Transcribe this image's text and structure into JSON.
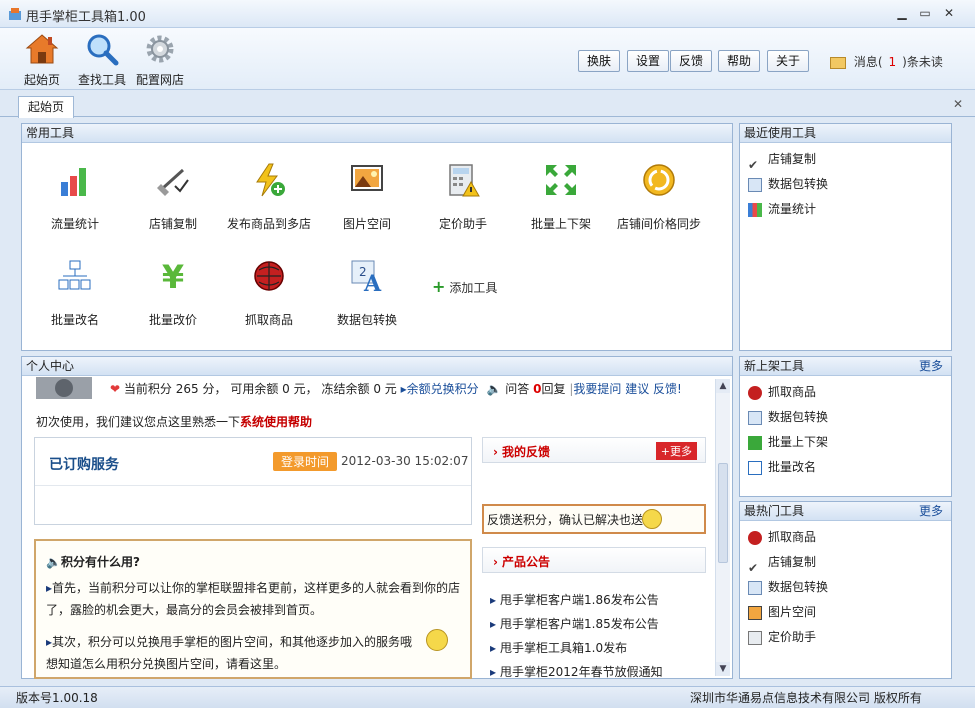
{
  "window": {
    "title": "甩手掌柜工具箱1.00"
  },
  "toolbar": {
    "home_label": "起始页",
    "find_label": "查找工具",
    "config_label": "配置网店",
    "buttons": [
      "换肤",
      "设置",
      "反馈",
      "帮助",
      "关于"
    ],
    "msg_prefix": "消息(",
    "msg_count": "1",
    "msg_suffix": ")条未读"
  },
  "tabs": {
    "start": "起始页"
  },
  "common": {
    "title": "常用工具",
    "tools": [
      "流量统计",
      "店铺复制",
      "发布商品到多店",
      "图片空间",
      "定价助手",
      "批量上下架",
      "店铺间价格同步",
      "批量改名",
      "批量改价",
      "抓取商品",
      "数据包转换"
    ],
    "add_label": "添加工具"
  },
  "recent": {
    "title": "最近使用工具",
    "items": [
      "店铺复制",
      "数据包转换",
      "流量统计"
    ]
  },
  "newtools": {
    "title": "新上架工具",
    "more": "更多",
    "items": [
      "抓取商品",
      "数据包转换",
      "批量上下架",
      "批量改名"
    ]
  },
  "hot": {
    "title": "最热门工具",
    "more": "更多",
    "items": [
      "抓取商品",
      "店铺复制",
      "数据包转换",
      "图片空间",
      "定价助手"
    ]
  },
  "personal": {
    "title": "个人中心",
    "stats": {
      "points_label": "当前积分",
      "points": "265",
      "points_unit": "分，",
      "avail_label": "可用余额",
      "avail": "0",
      "avail_unit": "元，",
      "frozen_label": "冻结余额",
      "frozen": "0",
      "frozen_unit": "元",
      "exchange": "余额兑换积分",
      "qa": "问答",
      "reply_count": "0",
      "reply": "回复",
      "suggest": "我要提问 建议 反馈!"
    },
    "hint_prefix": "初次使用，我们建议您点这里熟悉一下",
    "hint_link": "系统使用帮助",
    "service": {
      "title": "已订购服务",
      "login_badge": "登录时间",
      "login_time": "2012-03-30 15:02:07"
    },
    "feedback": {
      "title": "我的反馈",
      "more": "+更多",
      "note": "反馈送积分，确认已解决也送"
    },
    "points_box": {
      "title": "积分有什么用?",
      "p1": "首先，当前积分可以让你的掌柜联盟排名更前，这样更多的人就会看到你的店了，露脸的机会更大，最高分的会员会被排到首页。",
      "p2a": "其次，积分可以兑换甩手掌柜的图片空间，和其他逐步加入的服务哦",
      "p2b": "想知道怎么用积分兑换图片空间，请看这里。"
    },
    "announce": {
      "title": "产品公告",
      "items": [
        "甩手掌柜客户端1.86发布公告",
        "甩手掌柜客户端1.85发布公告",
        "甩手掌柜工具箱1.0发布",
        "甩手掌柜2012年春节放假通知"
      ]
    }
  },
  "status": {
    "version": "版本号1.00.18",
    "copyright": "深圳市华通易点信息技术有限公司 版权所有"
  }
}
